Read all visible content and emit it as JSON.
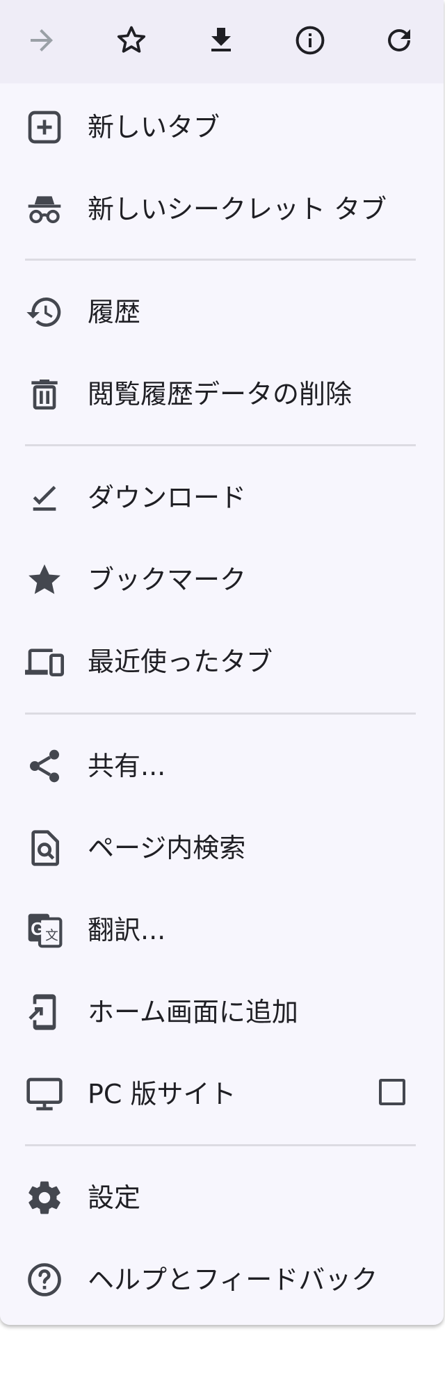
{
  "colors": {
    "menu_background": "#f7f6fd",
    "toolbar_background": "#efedf7",
    "icon": "#44474f",
    "icon_disabled": "#9aa0a6",
    "text": "#1f1f24",
    "divider": "#dcdbe2"
  },
  "toolbar": {
    "buttons": [
      {
        "name": "forward",
        "icon": "arrow-right-icon",
        "enabled": false
      },
      {
        "name": "bookmark",
        "icon": "star-outline-icon",
        "enabled": true
      },
      {
        "name": "download",
        "icon": "download-icon",
        "enabled": true
      },
      {
        "name": "page-info",
        "icon": "info-icon",
        "enabled": true
      },
      {
        "name": "reload",
        "icon": "refresh-icon",
        "enabled": true
      }
    ]
  },
  "menu": {
    "new_tab": {
      "label": "新しいタブ",
      "icon": "plus-box-icon"
    },
    "new_incognito_tab": {
      "label": "新しいシークレット タブ",
      "icon": "incognito-icon"
    },
    "history": {
      "label": "履歴",
      "icon": "history-icon"
    },
    "clear_browsing_data": {
      "label": "閲覧履歴データの削除",
      "icon": "trash-icon"
    },
    "downloads": {
      "label": "ダウンロード",
      "icon": "download-done-icon"
    },
    "bookmarks": {
      "label": "ブックマーク",
      "icon": "star-filled-icon"
    },
    "recent_tabs": {
      "label": "最近使ったタブ",
      "icon": "devices-icon"
    },
    "share": {
      "label": "共有...",
      "icon": "share-icon"
    },
    "find_in_page": {
      "label": "ページ内検索",
      "icon": "find-in-page-icon"
    },
    "translate": {
      "label": "翻訳...",
      "icon": "translate-icon"
    },
    "add_to_home": {
      "label": "ホーム画面に追加",
      "icon": "add-to-home-icon"
    },
    "desktop_site": {
      "label": "PC 版サイト",
      "icon": "monitor-icon",
      "checked": false
    },
    "settings": {
      "label": "設定",
      "icon": "gear-icon"
    },
    "help": {
      "label": "ヘルプとフィードバック",
      "icon": "help-icon"
    }
  }
}
